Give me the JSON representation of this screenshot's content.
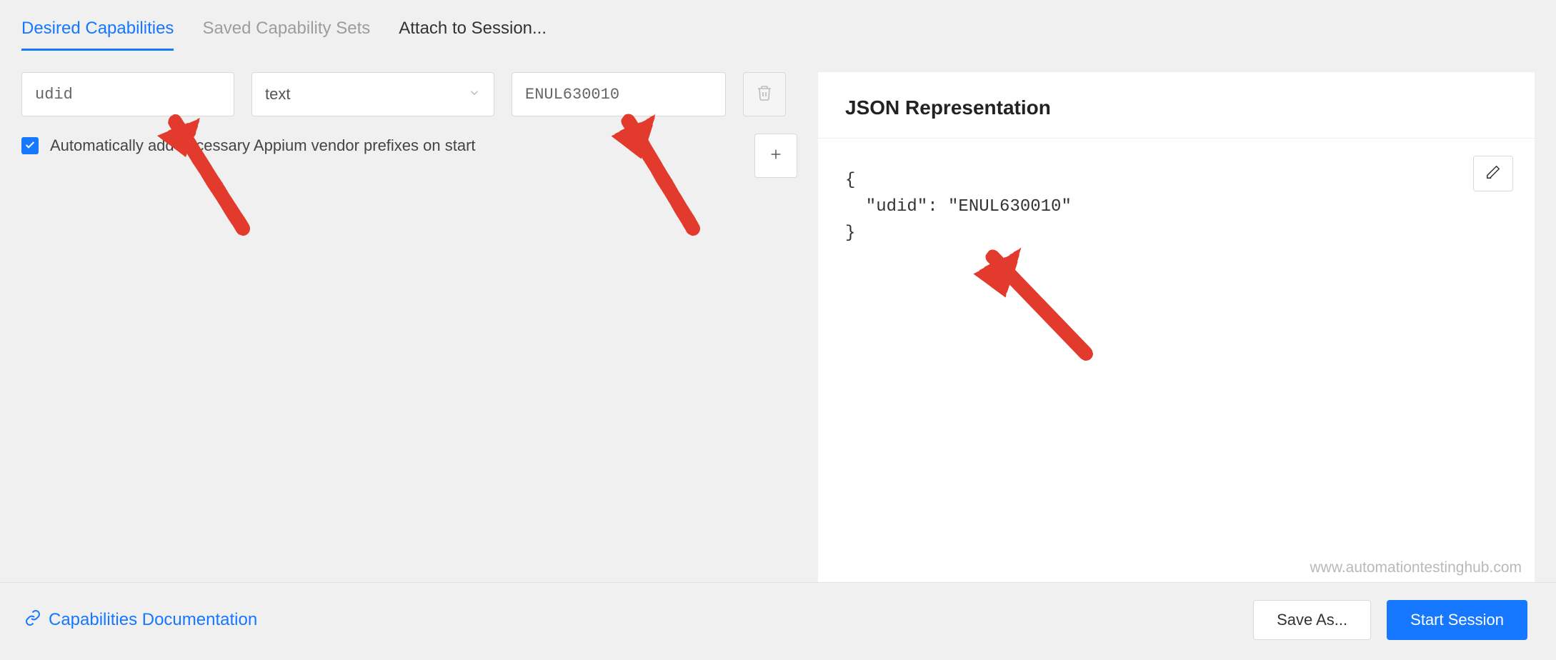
{
  "tabs": {
    "desired": "Desired Capabilities",
    "saved": "Saved Capability Sets",
    "attach": "Attach to Session..."
  },
  "capability": {
    "name": "udid",
    "type": "text",
    "value": "ENUL630010"
  },
  "checkbox": {
    "label": "Automatically add necessary Appium vendor prefixes on start",
    "checked": true
  },
  "json_panel": {
    "title": "JSON Representation",
    "code": "{\n  \"udid\": \"ENUL630010\"\n}"
  },
  "watermark": "www.automationtestinghub.com",
  "footer": {
    "doc_link": "Capabilities Documentation",
    "save_as": "Save As...",
    "start": "Start Session"
  }
}
